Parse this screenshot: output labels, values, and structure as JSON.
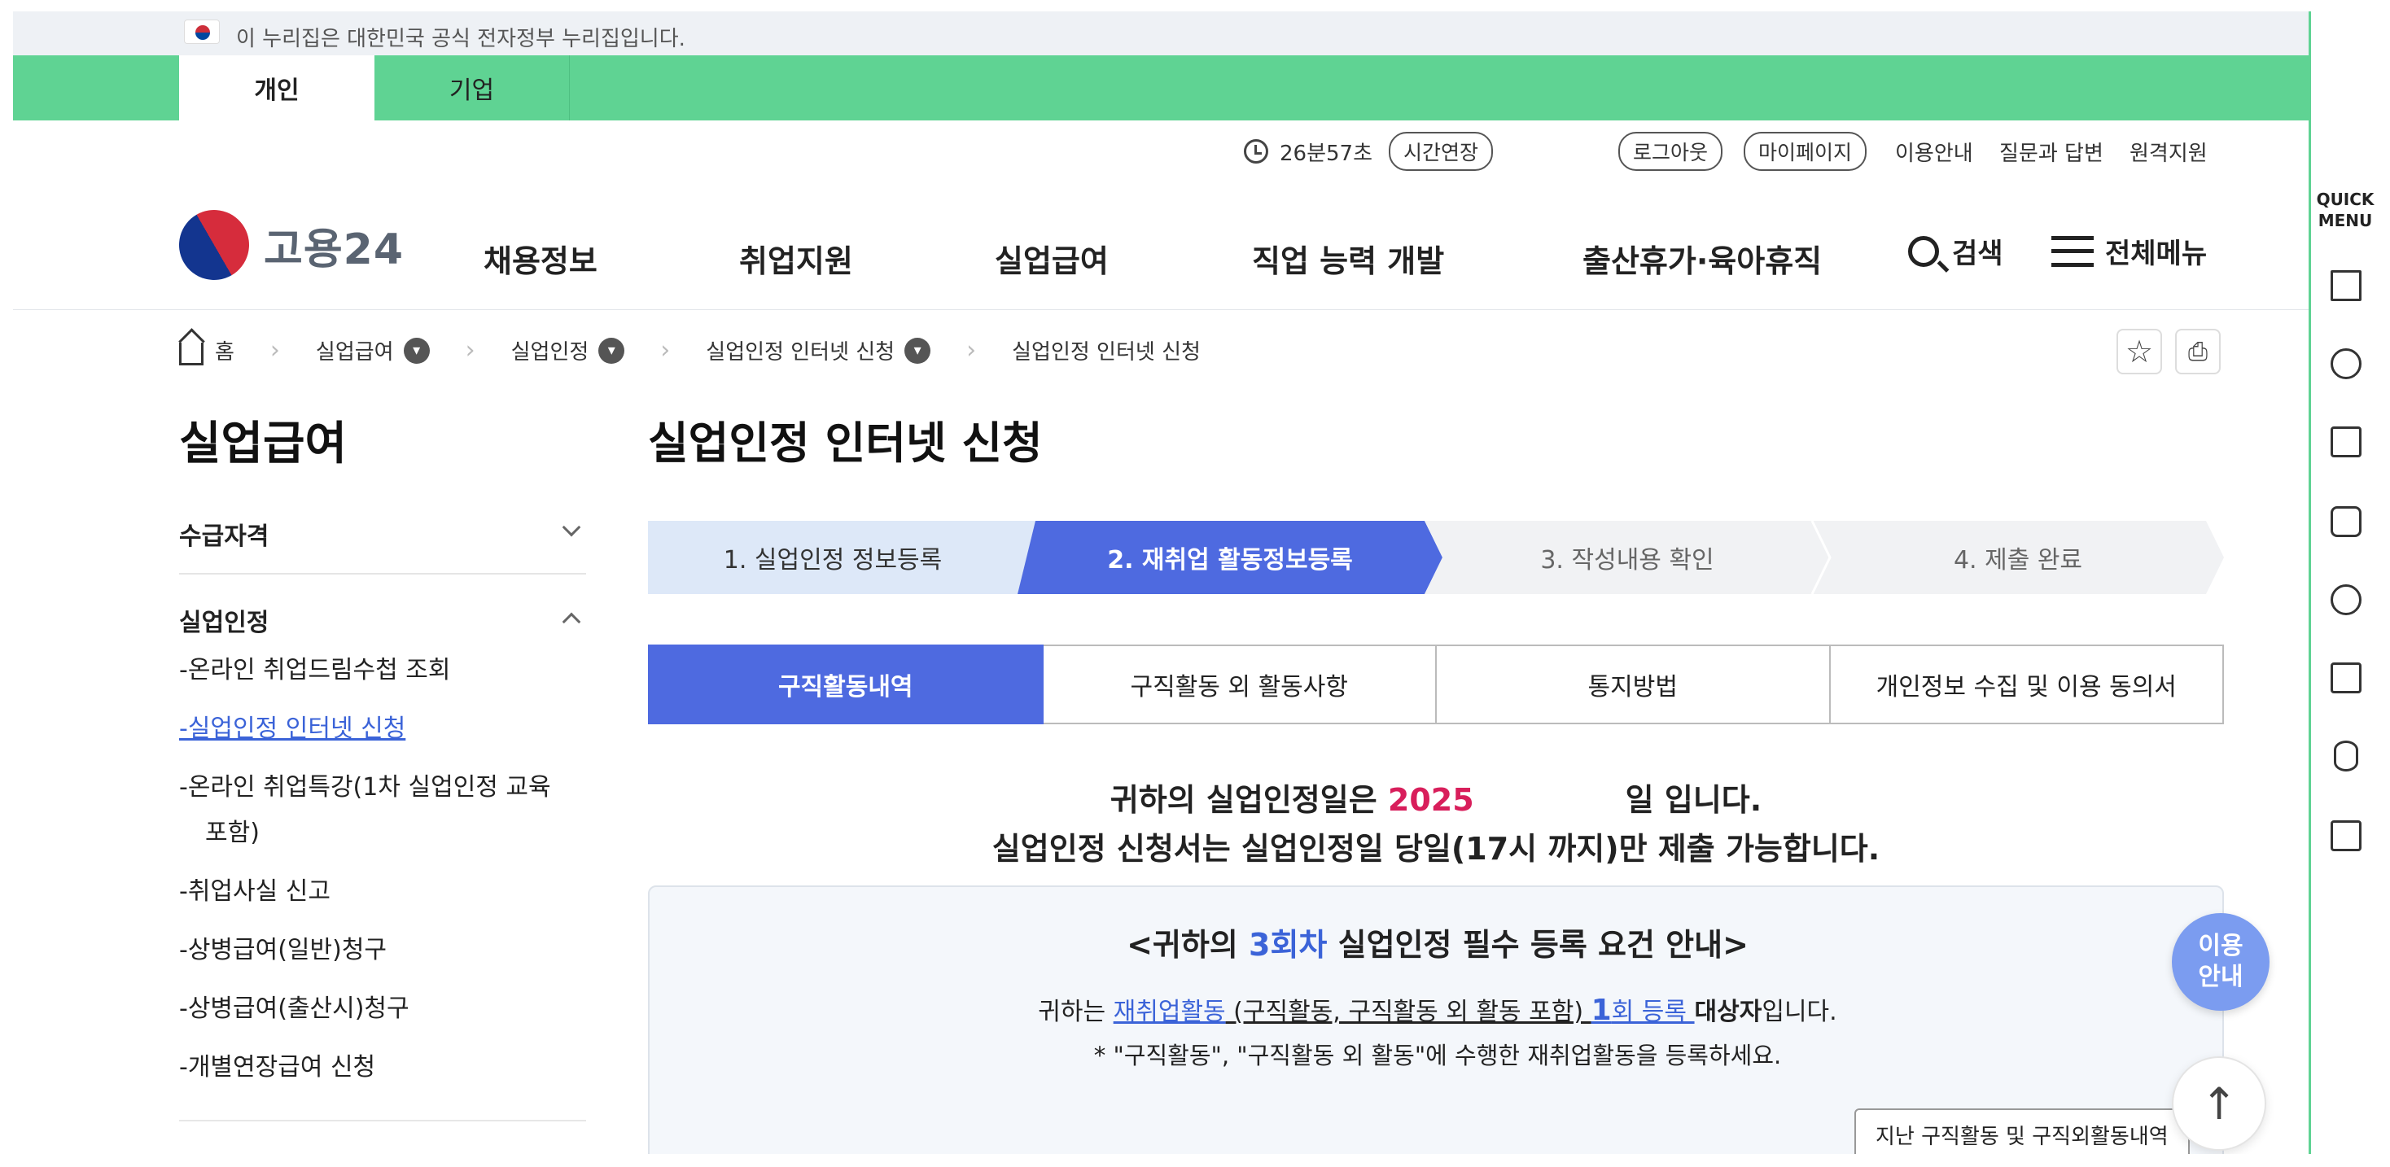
{
  "gov_banner": {
    "text": "이 누리집은 대한민국 공식 전자정부 누리집입니다."
  },
  "user_tabs": {
    "personal": "개인",
    "company": "기업"
  },
  "utility": {
    "timer": "26분57초",
    "extend": "시간연장",
    "logout": "로그아웃",
    "mypage": "마이페이지",
    "guide": "이용안내",
    "qna": "질문과 답변",
    "remote": "원격지원"
  },
  "logo": {
    "text": "고용24"
  },
  "gnb": [
    "채용정보",
    "취업지원",
    "실업급여",
    "직업 능력 개발",
    "출산휴가·육아휴직"
  ],
  "search_label": "검색",
  "all_menu_label": "전체메뉴",
  "breadcrumb": [
    "홈",
    "실업급여",
    "실업인정",
    "실업인정 인터넷 신청",
    "실업인정 인터넷 신청"
  ],
  "lnb": {
    "title": "실업급여",
    "sections": [
      "수급자격",
      "실업인정"
    ],
    "items": [
      "-온라인 취업드림수첩 조회",
      "-실업인정 인터넷 신청",
      "-온라인 취업특강(1차 실업인정 교육",
      "포함)",
      "-취업사실 신고",
      "-상병급여(일반)청구",
      "-상병급여(출산시)청구",
      "-개별연장급여 신청"
    ]
  },
  "page_title": "실업인정 인터넷 신청",
  "steps": [
    "1. 실업인정 정보등록",
    "2. 재취업 활동정보등록",
    "3. 작성내용 확인",
    "4. 제출 완료"
  ],
  "sub_tabs": [
    "구직활동내역",
    "구직활동 외 활동사항",
    "통지방법",
    "개인정보 수집 및 이용 동의서"
  ],
  "notice": {
    "prefix": "귀하의 실업인정일은 ",
    "date": "2025",
    "suffix": "일 입니다.",
    "line2": "실업인정 신청서는 실업인정일 당일(17시 까지)만 제출 가능합니다."
  },
  "info": {
    "title_pre": "<귀하의 ",
    "title_round": "3회차",
    "title_post": " 실업인정 필수 등록 요건 안내>",
    "l1_pre": "귀하는 ",
    "l1_link": "재취업활동",
    "l1_paren": " (구직활동, 구직활동 외 활동 포함) ",
    "l1_count": "1",
    "l1_count_suffix": "회 등록 ",
    "l1_target": "대상자",
    "l1_end": "입니다.",
    "l2": "* \"구직활동\", \"구직활동 외 활동\"에 수행한 재취업활동을 등록하세요.",
    "past_button": "지난 구직활동 및 구직외활동내역"
  },
  "help_button": [
    "이용",
    "안내"
  ],
  "quick_menu_title": [
    "QUICK",
    "MENU"
  ],
  "colors": {
    "green": "#5fd393",
    "blue": "#4e6ae0",
    "red": "#d81e5b",
    "link": "#3b63d8"
  }
}
